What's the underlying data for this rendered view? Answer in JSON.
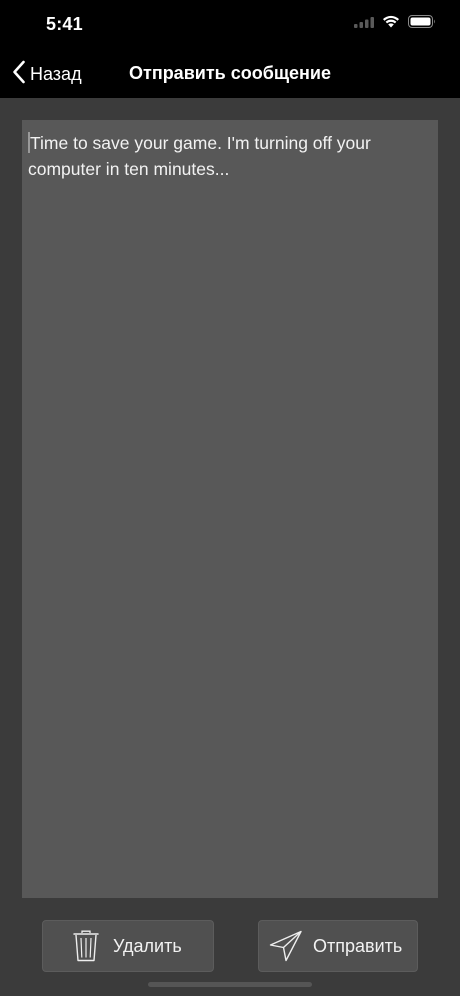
{
  "status_bar": {
    "time": "5:41",
    "icons": [
      "cellular-signal-icon",
      "wifi-icon",
      "battery-icon"
    ]
  },
  "nav": {
    "back_label": "Назад",
    "title": "Отправить сообщение"
  },
  "message": {
    "text": "Time to save your game. I'm turning off your computer in ten minutes..."
  },
  "actions": {
    "delete_label": "Удалить",
    "send_label": "Отправить"
  },
  "colors": {
    "background": "#3b3b3b",
    "message_box": "#585858",
    "bar": "#000000",
    "button": "#505050",
    "text": "#f2f2f2"
  }
}
